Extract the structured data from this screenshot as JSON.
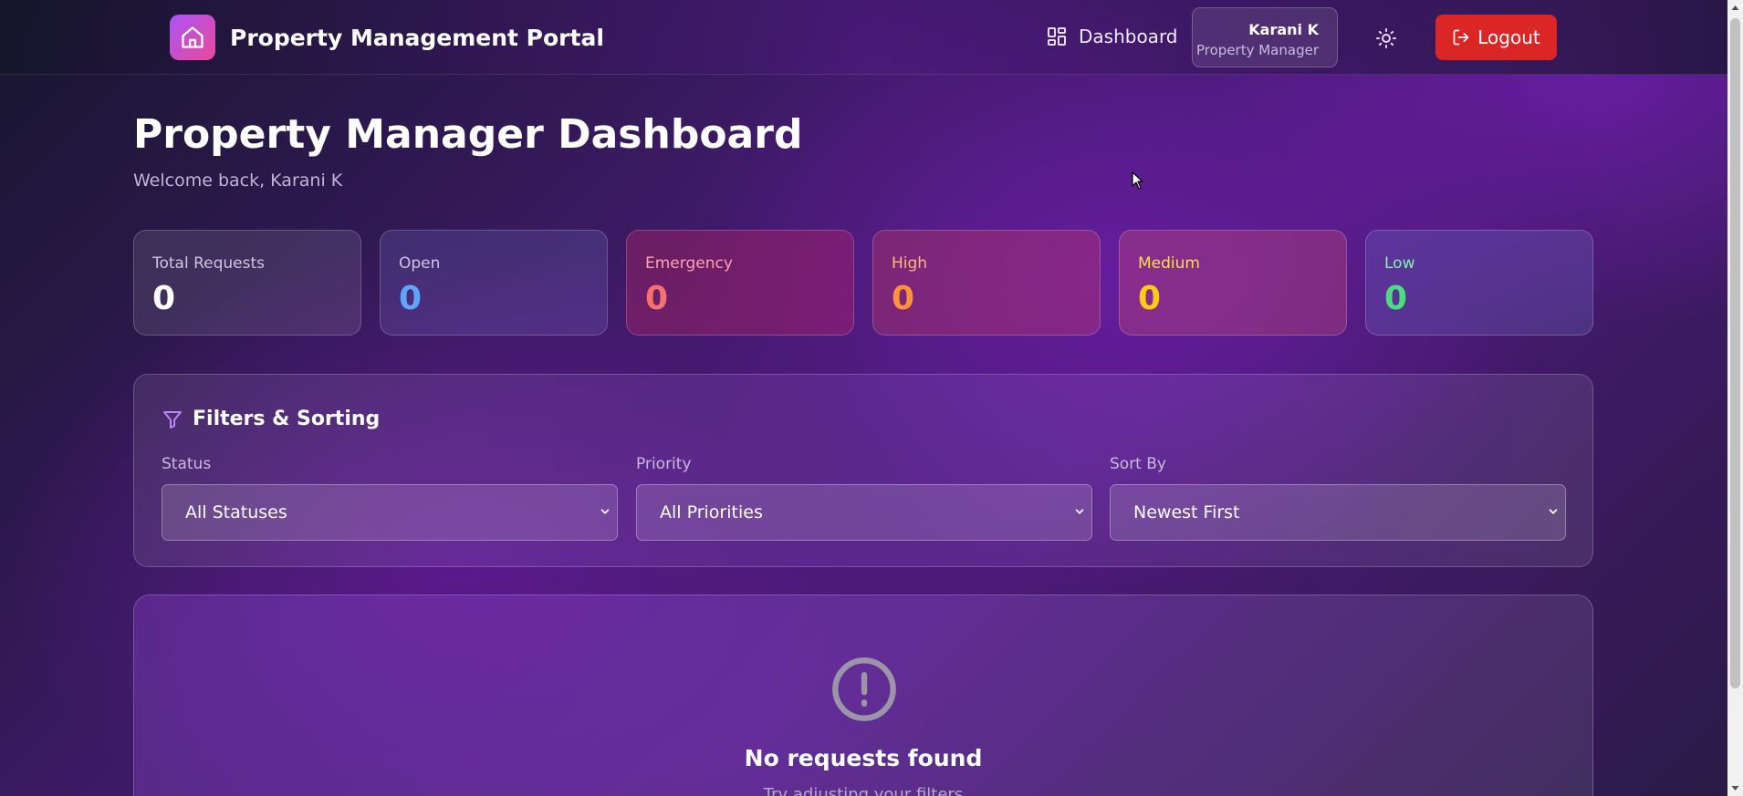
{
  "header": {
    "app_title": "Property Management Portal",
    "nav_dashboard": "Dashboard",
    "user_name": "Karani K",
    "user_role": "Property Manager",
    "logout_label": "Logout",
    "logo_icon": "home-icon",
    "theme_icon": "sun-icon"
  },
  "page": {
    "title": "Property Manager Dashboard",
    "welcome": "Welcome back, Karani K"
  },
  "stats": [
    {
      "label": "Total Requests",
      "value": "0",
      "label_color": "#cfc4e0",
      "value_color": "#ffffff",
      "bg": "rgba(255,255,255,0.10)"
    },
    {
      "label": "Open",
      "value": "0",
      "label_color": "#cfc4e0",
      "value_color": "#60a5fa",
      "bg": "rgba(150,160,255,0.16)"
    },
    {
      "label": "Emergency",
      "value": "0",
      "label_color": "#fda4af",
      "value_color": "#f87171",
      "bg": "rgba(220,40,100,0.30)"
    },
    {
      "label": "High",
      "value": "0",
      "label_color": "#fdba74",
      "value_color": "#fb923c",
      "bg": "rgba(230,70,90,0.28)"
    },
    {
      "label": "Medium",
      "value": "0",
      "label_color": "#fde047",
      "value_color": "#facc15",
      "bg": "rgba(230,90,110,0.28)"
    },
    {
      "label": "Low",
      "value": "0",
      "label_color": "#86efac",
      "value_color": "#4ade80",
      "bg": "rgba(110,110,200,0.30)"
    }
  ],
  "filters": {
    "title": "Filters & Sorting",
    "status_label": "Status",
    "status_value": "All Statuses",
    "priority_label": "Priority",
    "priority_value": "All Priorities",
    "sort_label": "Sort By",
    "sort_value": "Newest First"
  },
  "empty": {
    "title": "No requests found",
    "subtitle": "Try adjusting your filters"
  }
}
